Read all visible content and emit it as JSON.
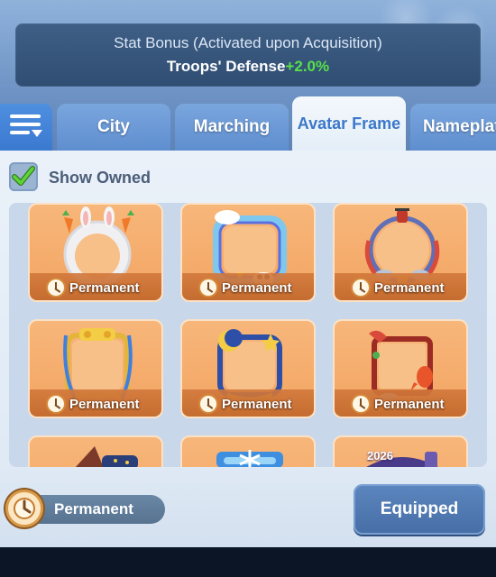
{
  "stat_bonus": {
    "title": "Stat Bonus (Activated upon Acquisition)",
    "stat_name": "Troops' Defense",
    "stat_value": "+2.0%"
  },
  "tabs": [
    {
      "label": "City",
      "active": false
    },
    {
      "label": "Marching",
      "active": false
    },
    {
      "label": "Avatar Frame",
      "active": true
    },
    {
      "label": "Nameplate",
      "active": false
    }
  ],
  "filter": {
    "label": "Show Owned",
    "checked": true
  },
  "items": [
    {
      "label": "Permanent",
      "icon": "bunny-carrot-frame-icon"
    },
    {
      "label": "Permanent",
      "icon": "rainbow-cloud-frame-icon"
    },
    {
      "label": "Permanent",
      "icon": "dragon-lantern-frame-icon"
    },
    {
      "label": "Permanent",
      "icon": "gold-ribbon-frame-icon"
    },
    {
      "label": "Permanent",
      "icon": "moon-star-frame-icon"
    },
    {
      "label": "Permanent",
      "icon": "koi-fish-frame-icon"
    },
    {
      "label": "",
      "icon": "wizard-hat-frame-icon"
    },
    {
      "label": "",
      "icon": "snowflake-frame-icon"
    },
    {
      "label": "2026",
      "icon": "new-year-2026-frame-icon"
    }
  ],
  "footer": {
    "duration_label": "Permanent",
    "equip_label": "Equipped"
  },
  "colors": {
    "stat_value": "#56e04a",
    "active_tab_text": "#3c78c9",
    "card": "#f3a562"
  }
}
